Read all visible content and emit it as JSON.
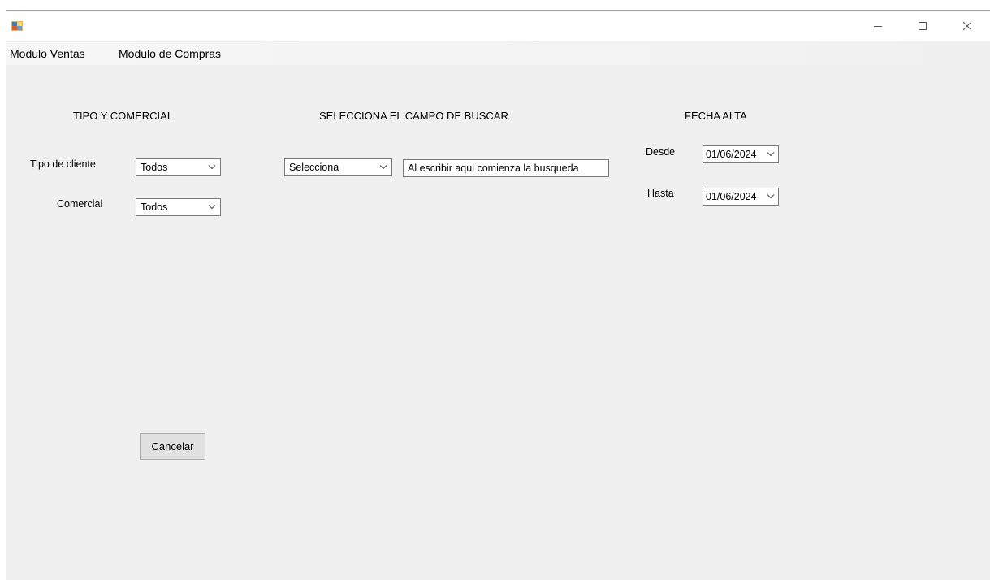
{
  "window": {
    "icon": "form-icon",
    "controls": [
      "minimize-icon",
      "maximize-icon",
      "close-icon"
    ]
  },
  "menu": {
    "items": [
      "Modulo Ventas",
      "Modulo de Compras"
    ]
  },
  "left_section": {
    "title": "TIPO Y COMERCIAL",
    "tipo_label": "Tipo de cliente",
    "tipo_value": "Todos",
    "comercial_label": "Comercial",
    "comercial_value": "Todos"
  },
  "search_section": {
    "title": "SELECCIONA EL CAMPO DE BUSCAR",
    "field_value": "Selecciona",
    "search_text": "Al escribir aqui comienza la busqueda"
  },
  "date_section": {
    "title": "FECHA ALTA",
    "desde_label": "Desde",
    "desde_value": "01/06/2024",
    "hasta_label": "Hasta",
    "hasta_value": "01/06/2024"
  },
  "actions": {
    "cancel_label": "Cancelar"
  }
}
